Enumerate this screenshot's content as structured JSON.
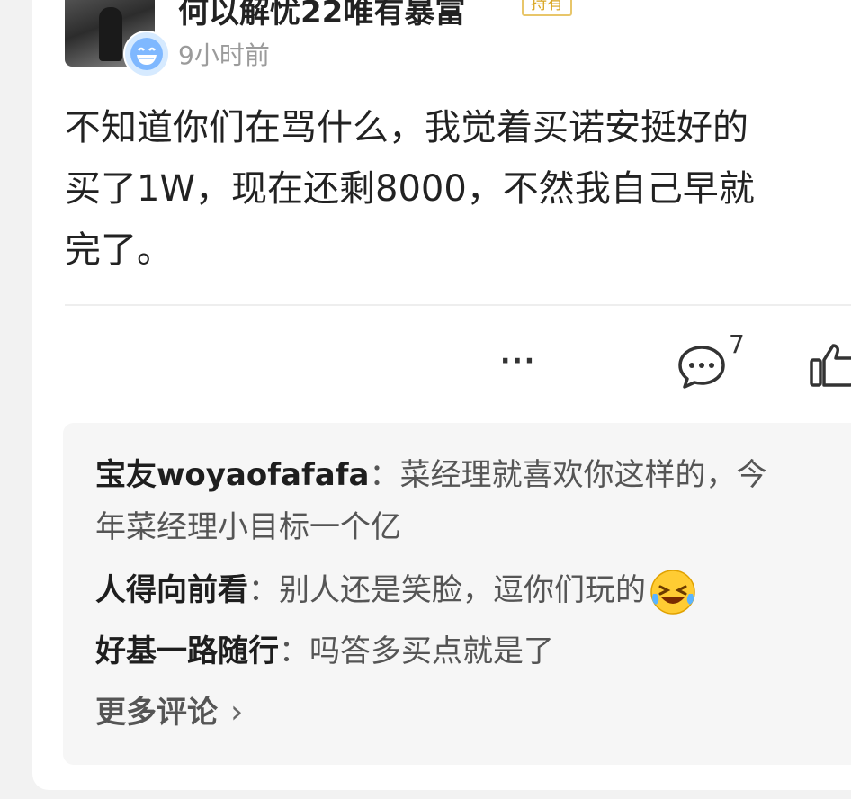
{
  "post": {
    "author": "何以解忧22唯有暴富",
    "author_tag": "持有",
    "time": "9小时前",
    "text_lines": [
      "不知道你们在骂什么，我觉着买诺安挺好的",
      "买了1W，现在还剩8000，不然我自己早就",
      "完了。"
    ],
    "comment_count": "7"
  },
  "replies": [
    {
      "author": "宝友woyaofafafa",
      "text_line1": "菜经理就喜欢你这样的，今",
      "text_line2": "年菜经理小目标一个亿"
    },
    {
      "author": "人得向前看",
      "text": "别人还是笑脸，逗你们玩的"
    },
    {
      "author": "好基一路随行",
      "text": "吗答多买点就是了"
    }
  ],
  "colon": "：",
  "more_comments": "更多评论",
  "chevron": "›",
  "icons": {
    "more": "more-dots-icon",
    "comment": "comment-bubble-icon",
    "like": "thumbs-up-icon",
    "emoji_badge": "grinning-face-icon",
    "reply_emoji": "laughing-tears-face-icon"
  },
  "colors": {
    "tag_border": "#e8c66a",
    "tag_text": "#d9a520",
    "reply_bg": "#f6f6f6"
  }
}
